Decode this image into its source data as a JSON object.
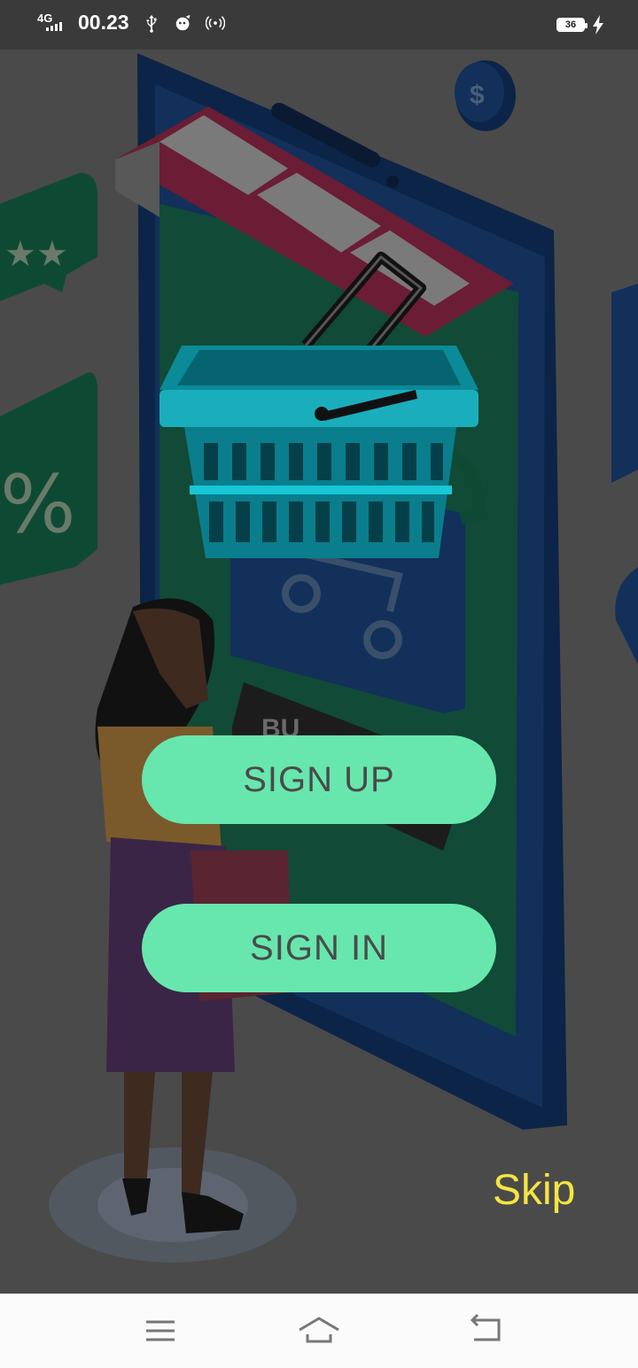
{
  "status_bar": {
    "network": "4G",
    "time": "00.23",
    "battery": "36",
    "icons": [
      "signal-icon",
      "usb-icon",
      "notification-icon",
      "hotspot-icon",
      "battery-icon",
      "charging-icon"
    ]
  },
  "illustration": {
    "description_icon": "shopping-illustration",
    "sign_text": "BU"
  },
  "buttons": {
    "sign_up": "SIGN UP",
    "sign_in": "SIGN IN"
  },
  "skip_label": "Skip",
  "colors": {
    "button_bg": "#67e7ae",
    "button_text": "#4a4a4a",
    "skip_text": "#f4e542",
    "overlay": "#4a4a4a"
  },
  "nav_bar": {
    "icons": [
      "menu-icon",
      "home-icon",
      "back-icon"
    ]
  }
}
